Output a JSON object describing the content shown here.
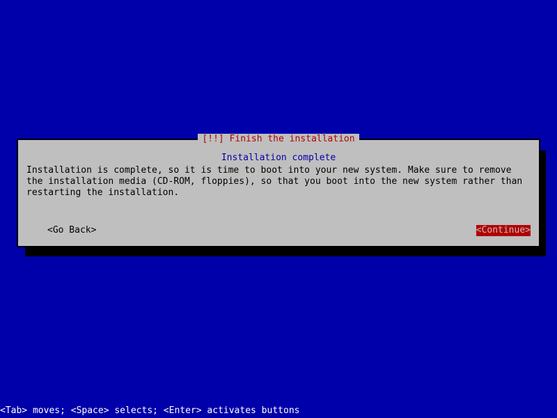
{
  "dialog": {
    "title": "[!!] Finish the installation",
    "subtitle": "Installation complete",
    "body": "Installation is complete, so it is time to boot into your new system. Make sure to remove the installation media (CD-ROM, floppies), so that you boot into the new system rather than restarting the installation.",
    "go_back": "<Go Back>",
    "continue": "<Continue>"
  },
  "status": "<Tab> moves; <Space> selects; <Enter> activates buttons"
}
